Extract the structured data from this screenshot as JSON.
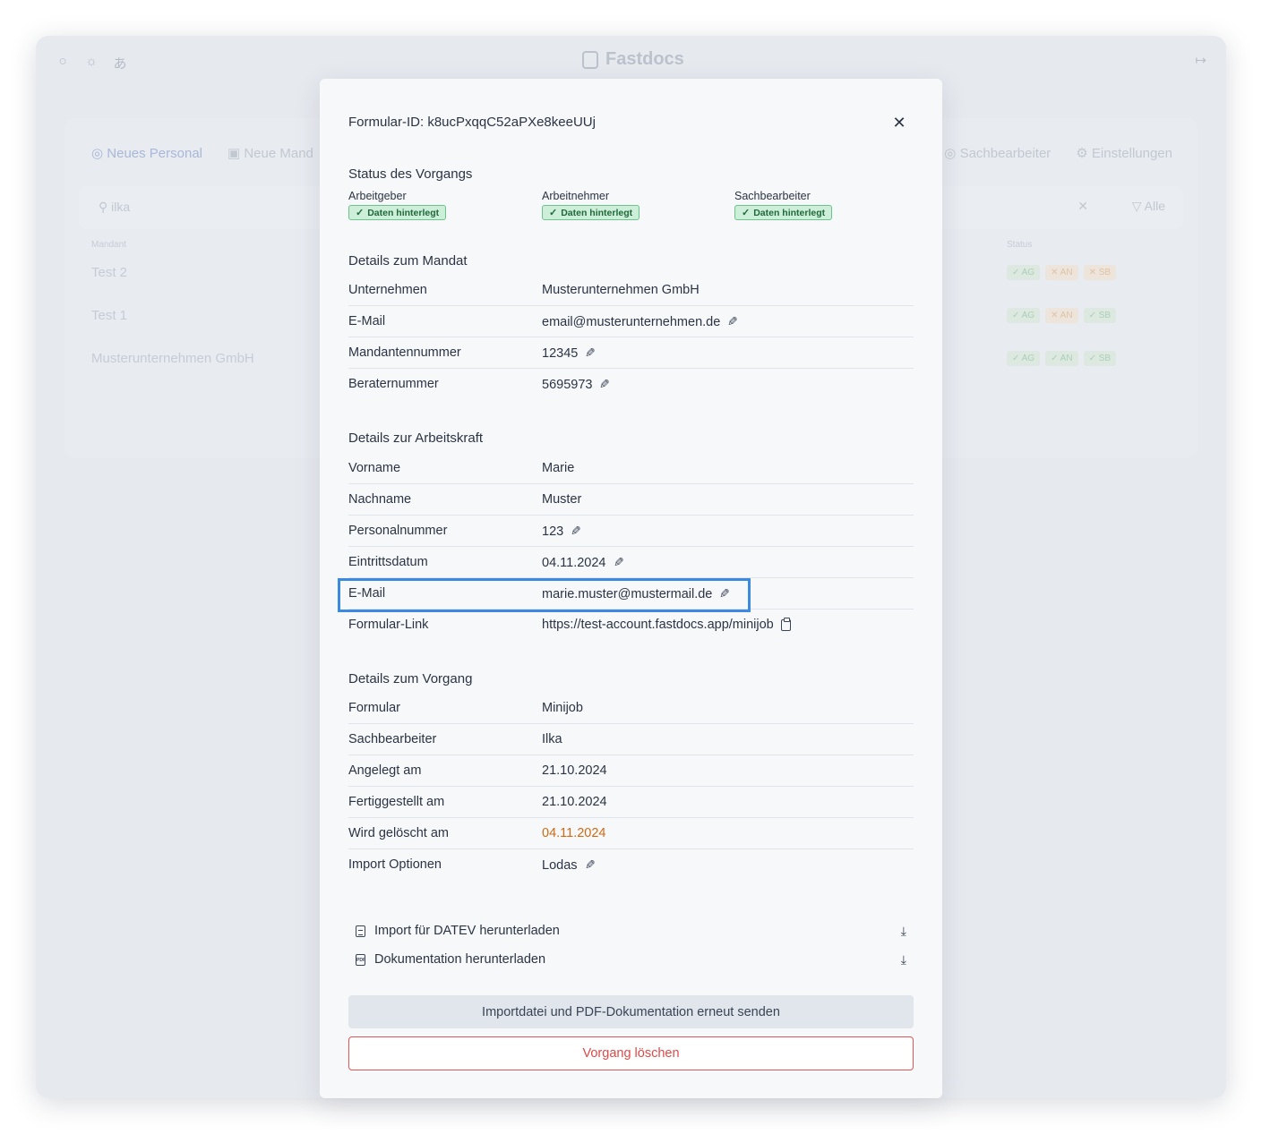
{
  "app": {
    "brand": "Fastdocs",
    "nav_tabs": [
      "Neues Personal",
      "Neue Mand"
    ],
    "nav_right": [
      "Sachbearbeiter",
      "Einstellungen"
    ],
    "search_value": "ilka",
    "filter_label": "Alle",
    "table_headers": [
      "Mandant",
      "Status"
    ],
    "rows": [
      {
        "name": "Test 2",
        "badges": [
          {
            "label": "AG",
            "ok": true
          },
          {
            "label": "AN",
            "ok": false
          },
          {
            "label": "SB",
            "ok": false
          }
        ]
      },
      {
        "name": "Test 1",
        "badges": [
          {
            "label": "AG",
            "ok": true
          },
          {
            "label": "AN",
            "ok": false
          },
          {
            "label": "SB",
            "ok": true
          }
        ]
      },
      {
        "name": "Musterunternehmen GmbH",
        "badges": [
          {
            "label": "AG",
            "ok": true
          },
          {
            "label": "AN",
            "ok": true
          },
          {
            "label": "SB",
            "ok": true
          }
        ]
      }
    ]
  },
  "modal": {
    "title": "Formular-ID: k8ucPxqqC52aPXe8keeUUj",
    "status": {
      "heading": "Status des Vorgangs",
      "columns": [
        {
          "label": "Arbeitgeber",
          "chip": "Daten hinterlegt"
        },
        {
          "label": "Arbeitnehmer",
          "chip": "Daten hinterlegt"
        },
        {
          "label": "Sachbearbeiter",
          "chip": "Daten hinterlegt"
        }
      ]
    },
    "mandat": {
      "heading": "Details zum Mandat",
      "rows": [
        {
          "key": "Unternehmen",
          "value": "Musterunternehmen GmbH"
        },
        {
          "key": "E-Mail",
          "value": "email@musterunternehmen.de"
        },
        {
          "key": "Mandantennummer",
          "value": "12345"
        },
        {
          "key": "Beraternummer",
          "value": "5695973"
        }
      ]
    },
    "arbeitskraft": {
      "heading": "Details zur Arbeitskraft",
      "rows": [
        {
          "key": "Vorname",
          "value": "Marie"
        },
        {
          "key": "Nachname",
          "value": "Muster"
        },
        {
          "key": "Personalnummer",
          "value": "123"
        },
        {
          "key": "Eintrittsdatum",
          "value": "04.11.2024"
        },
        {
          "key": "E-Mail",
          "value": "marie.muster@mustermail.de"
        },
        {
          "key": "Formular-Link",
          "value": "https://test-account.fastdocs.app/minijob"
        }
      ]
    },
    "vorgang": {
      "heading": "Details zum Vorgang",
      "rows": [
        {
          "key": "Formular",
          "value": "Minijob"
        },
        {
          "key": "Sachbearbeiter",
          "value": "Ilka"
        },
        {
          "key": "Angelegt am",
          "value": "21.10.2024"
        },
        {
          "key": "Fertiggestellt am",
          "value": "21.10.2024"
        },
        {
          "key": "Wird gelöscht am",
          "value": "04.11.2024"
        },
        {
          "key": "Import Optionen",
          "value": "Lodas"
        }
      ]
    },
    "downloads": {
      "datev": "Import für DATEV herunterladen",
      "docs": "Dokumentation herunterladen"
    },
    "buttons": {
      "resend": "Importdatei und PDF-Dokumentation erneut senden",
      "delete": "Vorgang löschen"
    }
  },
  "colors": {
    "highlight": "#3b8ae0",
    "warning": "#d06a12",
    "danger": "#e04848",
    "success_chip_bg": "#cdeed8"
  }
}
